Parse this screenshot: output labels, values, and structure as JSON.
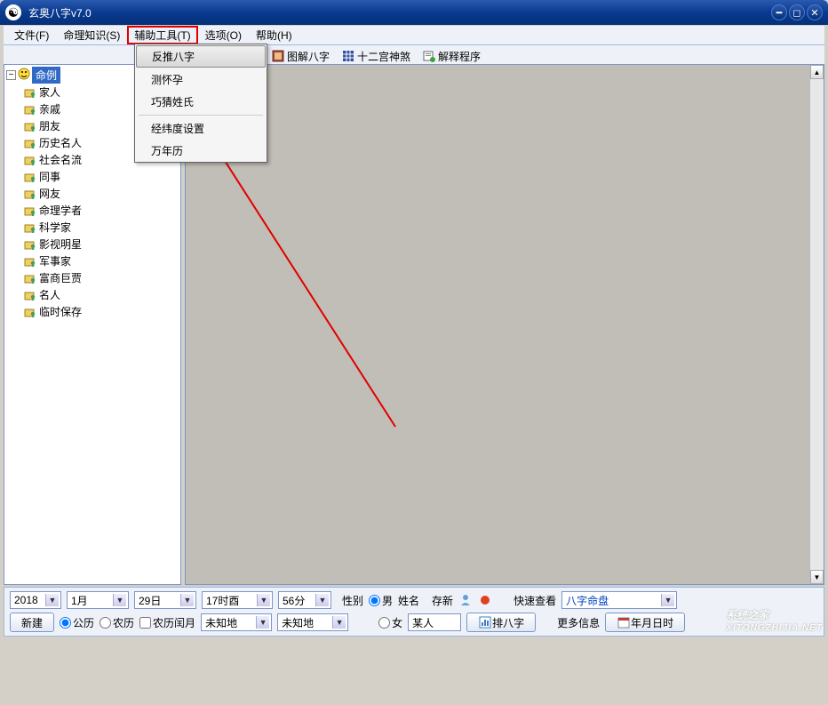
{
  "title": "玄奥八字v7.0",
  "menu": {
    "file": "文件(F)",
    "knowledge": "命理知识(S)",
    "tools": "辅助工具(T)",
    "options": "选项(O)",
    "help": "帮助(H)"
  },
  "toolbar": {
    "tushi": "图解八字",
    "shensha": "十二宫神煞",
    "jieshi": "解释程序"
  },
  "dropdown": {
    "fantui": "反推八字",
    "cehuaiyun": "测怀孕",
    "qiaocai": "巧猜姓氏",
    "jingwei": "经纬度设置",
    "wannianli": "万年历"
  },
  "tree": {
    "root": "命例",
    "items": [
      "家人",
      "亲戚",
      "朋友",
      "历史名人",
      "社会名流",
      "同事",
      "网友",
      "命理学者",
      "科学家",
      "影视明星",
      "军事家",
      "富商巨贾",
      "名人",
      "临时保存"
    ]
  },
  "bottom": {
    "year": "2018",
    "month": "1月",
    "day": "29日",
    "hour": "17时酉",
    "minute": "56分",
    "xinjian": "新建",
    "gongli": "公历",
    "nongli": "农历",
    "runyue": "农历闰月",
    "weizhi1": "未知地",
    "weizhi2": "未知地",
    "xingbie": "性别",
    "nan": "男",
    "nv": "女",
    "xingming_label": "姓名",
    "xingming": "某人",
    "cunxin": "存新",
    "paibazi": "排八字",
    "kuaisu_label": "快速查看",
    "kuaisu": "八字命盘",
    "gengduo_label": "更多信息",
    "gengduo_btn": "年月日时"
  },
  "watermark": {
    "main": "系统之家",
    "sub": "XITONGZHIJIA.NET"
  }
}
